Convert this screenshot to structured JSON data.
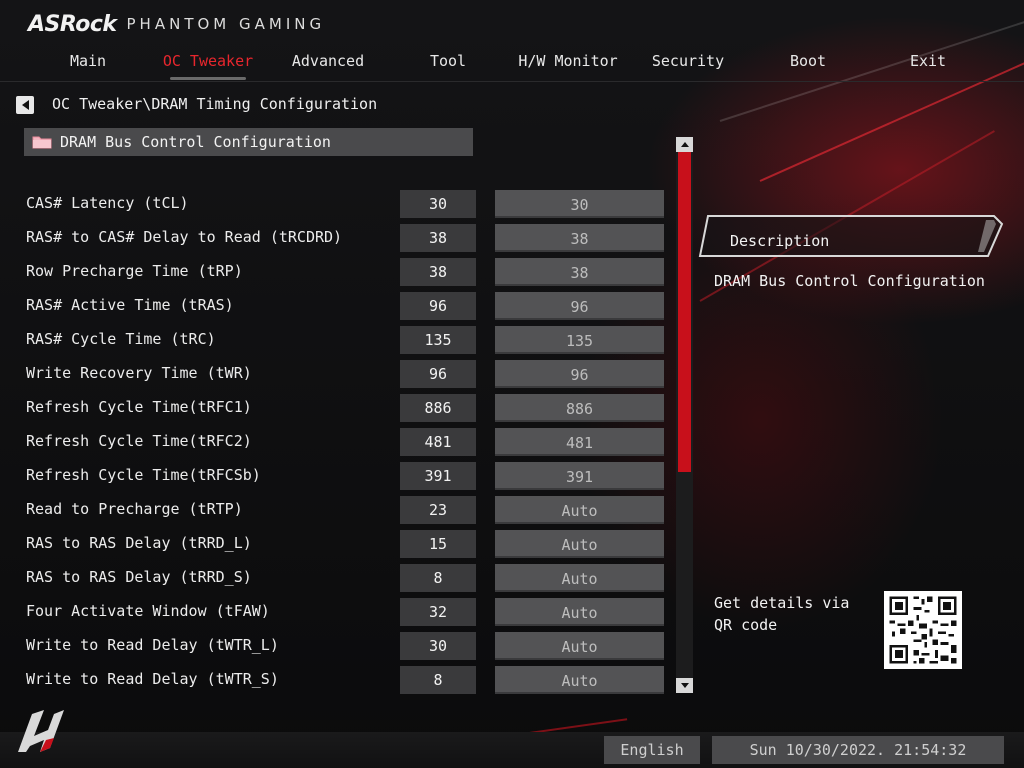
{
  "header": {
    "brand": "ASRock",
    "product": "PHANTOM GAMING",
    "tabs": [
      {
        "label": "Main"
      },
      {
        "label": "OC Tweaker"
      },
      {
        "label": "Advanced"
      },
      {
        "label": "Tool"
      },
      {
        "label": "H/W Monitor"
      },
      {
        "label": "Security"
      },
      {
        "label": "Boot"
      },
      {
        "label": "Exit"
      }
    ],
    "active_tab": "OC Tweaker"
  },
  "breadcrumb": "OC Tweaker\\DRAM Timing Configuration",
  "section": {
    "label": "DRAM Bus Control Configuration",
    "icon": "folder-icon"
  },
  "rows": [
    {
      "label": "CAS# Latency (tCL)",
      "current": "30",
      "setting": "30"
    },
    {
      "label": "RAS# to CAS# Delay to Read  (tRCDRD)",
      "current": "38",
      "setting": "38"
    },
    {
      "label": "Row Precharge Time (tRP)",
      "current": "38",
      "setting": "38"
    },
    {
      "label": "RAS# Active Time (tRAS)",
      "current": "96",
      "setting": "96"
    },
    {
      "label": "RAS# Cycle Time (tRC)",
      "current": "135",
      "setting": "135"
    },
    {
      "label": "Write Recovery Time (tWR)",
      "current": "96",
      "setting": "96"
    },
    {
      "label": "Refresh Cycle Time(tRFC1)",
      "current": "886",
      "setting": "886"
    },
    {
      "label": "Refresh Cycle Time(tRFC2)",
      "current": "481",
      "setting": "481"
    },
    {
      "label": "Refresh Cycle Time(tRFCSb)",
      "current": "391",
      "setting": "391"
    },
    {
      "label": "Read to Precharge (tRTP)",
      "current": "23",
      "setting": "Auto"
    },
    {
      "label": "RAS to RAS Delay (tRRD_L)",
      "current": "15",
      "setting": "Auto"
    },
    {
      "label": "RAS to RAS Delay (tRRD_S)",
      "current": "8",
      "setting": "Auto"
    },
    {
      "label": "Four Activate Window (tFAW)",
      "current": "32",
      "setting": "Auto"
    },
    {
      "label": "Write to Read Delay (tWTR_L)",
      "current": "30",
      "setting": "Auto"
    },
    {
      "label": "Write to Read Delay (tWTR_S)",
      "current": "8",
      "setting": "Auto"
    }
  ],
  "description": {
    "title": "Description",
    "text": "DRAM Bus Control Configuration"
  },
  "qr": {
    "text": "Get details via QR code"
  },
  "footer": {
    "language": "English",
    "datetime": "Sun 10/30/2022. 21:54:32"
  },
  "colors": {
    "accent": "#e8262d",
    "scroll_thumb": "#c8101b",
    "panel": "#4a4a4c"
  }
}
